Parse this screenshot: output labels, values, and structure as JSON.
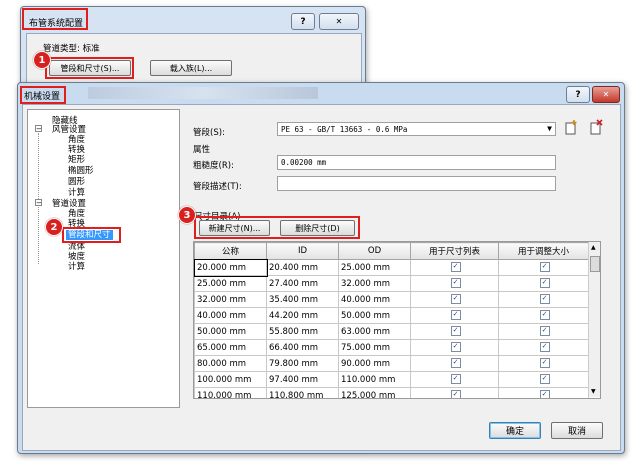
{
  "back_dialog": {
    "title": "布管系统配置",
    "help_label": "?",
    "close_label": "✕",
    "pipe_type_label": "管道类型: 标准",
    "segments_button": "管段和尺寸(S)...",
    "load_family_button": "载入族(L)..."
  },
  "main_dialog": {
    "title": "机械设置",
    "help_label": "?",
    "close_label": "✕",
    "tree": [
      {
        "label": "隐藏线",
        "level": 0
      },
      {
        "label": "风管设置",
        "level": 0,
        "expander": "−"
      },
      {
        "label": "角度",
        "level": 1
      },
      {
        "label": "转换",
        "level": 1
      },
      {
        "label": "矩形",
        "level": 1
      },
      {
        "label": "椭圆形",
        "level": 1
      },
      {
        "label": "圆形",
        "level": 1
      },
      {
        "label": "计算",
        "level": 1
      },
      {
        "label": "管道设置",
        "level": 0,
        "expander": "−"
      },
      {
        "label": "角度",
        "level": 1
      },
      {
        "label": "转换",
        "level": 1
      },
      {
        "label": "管段和尺寸",
        "level": 1,
        "selected": true
      },
      {
        "label": "流体",
        "level": 1
      },
      {
        "label": "坡度",
        "level": 1
      },
      {
        "label": "计算",
        "level": 1
      }
    ],
    "segment_label": "管段(S):",
    "segment_value": "PE 63 - GB/T 13663 - 0.6 MPa",
    "properties_label": "属性",
    "roughness_label": "粗糙度(R):",
    "roughness_value": "0.00200 mm",
    "description_label": "管段描述(T):",
    "description_value": "",
    "size_catalog_label": "尺寸目录(A)",
    "new_size_button": "新建尺寸(N)...",
    "delete_size_button": "删除尺寸(D)",
    "table": {
      "headers": [
        "公称",
        "ID",
        "OD",
        "用于尺寸列表",
        "用于调整大小"
      ],
      "rows": [
        {
          "nominal": "20.000 mm",
          "id": "20.400 mm",
          "od": "25.000 mm"
        },
        {
          "nominal": "25.000 mm",
          "id": "27.400 mm",
          "od": "32.000 mm"
        },
        {
          "nominal": "32.000 mm",
          "id": "35.400 mm",
          "od": "40.000 mm"
        },
        {
          "nominal": "40.000 mm",
          "id": "44.200 mm",
          "od": "50.000 mm"
        },
        {
          "nominal": "50.000 mm",
          "id": "55.800 mm",
          "od": "63.000 mm"
        },
        {
          "nominal": "65.000 mm",
          "id": "66.400 mm",
          "od": "75.000 mm"
        },
        {
          "nominal": "80.000 mm",
          "id": "79.800 mm",
          "od": "90.000 mm"
        },
        {
          "nominal": "100.000 mm",
          "id": "97.400 mm",
          "od": "110.000 mm"
        },
        {
          "nominal": "110.000 mm",
          "id": "110.800 mm",
          "od": "125.000 mm"
        }
      ],
      "check_glyph": "✓"
    },
    "ok_button": "确定",
    "cancel_button": "取消"
  },
  "badges": [
    "1",
    "2",
    "3"
  ],
  "colors": {
    "highlight_red": "#e01e1e",
    "selection_blue": "#3399ff",
    "title_bar": "#c9dbef"
  }
}
